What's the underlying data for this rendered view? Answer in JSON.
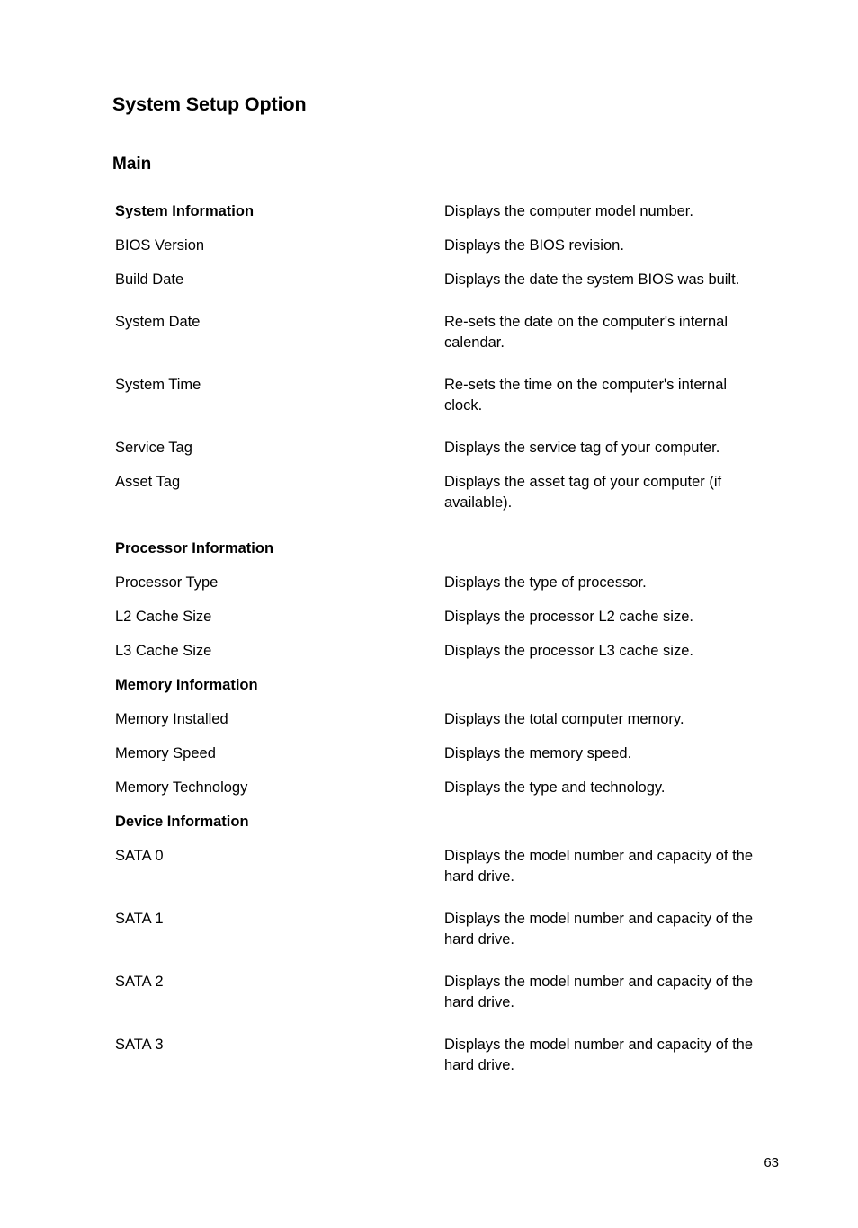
{
  "document": {
    "title": "System Setup Option",
    "section": "Main",
    "page_number": "63"
  },
  "rows": [
    {
      "label": "System Information",
      "desc": "Displays the computer model number.",
      "bold": true,
      "tall": false,
      "gap": false
    },
    {
      "label": "BIOS Version",
      "desc": "Displays the BIOS revision.",
      "bold": false,
      "tall": false,
      "gap": false
    },
    {
      "label": "Build Date",
      "desc": "Displays the date the system BIOS was built.",
      "bold": false,
      "tall": true,
      "gap": false
    },
    {
      "label": "System Date",
      "desc": "Re-sets the date on the computer's internal calendar.",
      "bold": false,
      "tall": true,
      "gap": false
    },
    {
      "label": "System Time",
      "desc": "Re-sets the time on the computer's internal clock.",
      "bold": false,
      "tall": true,
      "gap": false
    },
    {
      "label": "Service Tag",
      "desc": "Displays the service tag of your computer.",
      "bold": false,
      "tall": false,
      "gap": false
    },
    {
      "label": "Asset Tag",
      "desc": "Displays the asset tag of your computer (if available).",
      "bold": false,
      "tall": true,
      "gap": false
    },
    {
      "label": "Processor Information",
      "desc": "",
      "bold": true,
      "tall": false,
      "gap": true
    },
    {
      "label": "Processor Type",
      "desc": "Displays the type of processor.",
      "bold": false,
      "tall": false,
      "gap": false
    },
    {
      "label": "L2 Cache Size",
      "desc": "Displays the processor L2 cache size.",
      "bold": false,
      "tall": false,
      "gap": false
    },
    {
      "label": "L3 Cache Size",
      "desc": "Displays the processor L3 cache size.",
      "bold": false,
      "tall": false,
      "gap": false
    },
    {
      "label": "Memory Information",
      "desc": "",
      "bold": true,
      "tall": false,
      "gap": false
    },
    {
      "label": "Memory Installed",
      "desc": "Displays the total computer memory.",
      "bold": false,
      "tall": false,
      "gap": false
    },
    {
      "label": "Memory Speed",
      "desc": "Displays the memory speed.",
      "bold": false,
      "tall": false,
      "gap": false
    },
    {
      "label": "Memory Technology",
      "desc": "Displays the type and technology.",
      "bold": false,
      "tall": false,
      "gap": false
    },
    {
      "label": "Device Information",
      "desc": "",
      "bold": true,
      "tall": false,
      "gap": false
    },
    {
      "label": "SATA 0",
      "desc": "Displays the model number and capacity of the hard drive.",
      "bold": false,
      "tall": true,
      "gap": false
    },
    {
      "label": "SATA 1",
      "desc": "Displays the model number and capacity of the hard drive.",
      "bold": false,
      "tall": true,
      "gap": false
    },
    {
      "label": "SATA 2",
      "desc": "Displays the model number and capacity of the hard drive.",
      "bold": false,
      "tall": true,
      "gap": false
    },
    {
      "label": "SATA 3",
      "desc": "Displays the model number and capacity of the hard drive.",
      "bold": false,
      "tall": true,
      "gap": false
    }
  ]
}
